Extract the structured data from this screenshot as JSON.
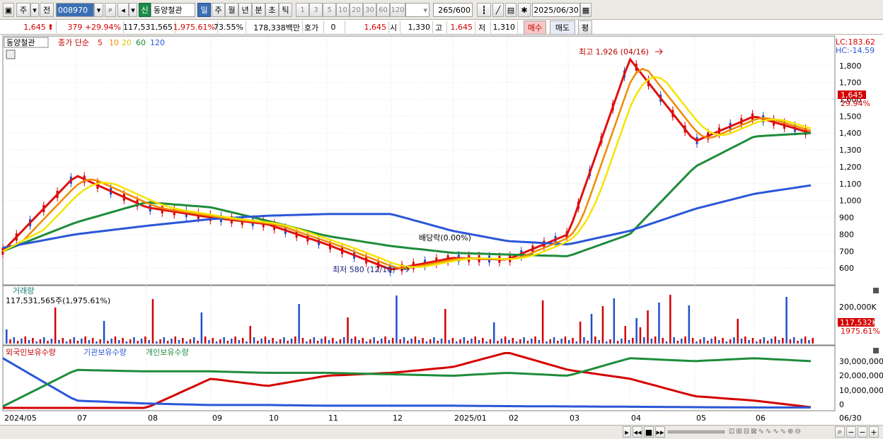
{
  "toolbar": {
    "market": "주",
    "scope": "전",
    "code": "008970",
    "badge": "신",
    "name": "동양철관",
    "periods": [
      "일",
      "주",
      "월",
      "년",
      "분",
      "초",
      "틱"
    ],
    "active_period": "일",
    "intervals": [
      "1",
      "3",
      "5",
      "10",
      "20",
      "30",
      "60",
      "120"
    ],
    "count": "265",
    "count_max": "/600",
    "date": "2025/06/30"
  },
  "quote": {
    "price": "1,645",
    "change": "379",
    "change_pct": "+29.94%",
    "volume": "117,531,565",
    "volume_pct": "1,975.61%",
    "rate": "73.55%",
    "amount": "178,338백만",
    "hoga_label": "호가",
    "hoga_value": "0",
    "ask_price": "1,645",
    "open_label": "시",
    "open": "1,330",
    "high_label": "고",
    "high": "1,645",
    "low_label": "저",
    "low": "1,310",
    "buy_btn": "매수",
    "sell_btn": "매도",
    "eval_btn": "평"
  },
  "price_panel": {
    "stock_label": "동양철관",
    "ma_label": "종가 단순",
    "ma_periods": [
      "5",
      "10",
      "20",
      "60",
      "120"
    ],
    "lc": "LC:183.62",
    "hc": "HC:-14.59",
    "max_note": "최고 1,926 (04/16)",
    "min_note": "최저 580 (12/10)",
    "event_note": "배당락(0.00%)",
    "last_price": "1,645",
    "last_pct": "29.94%",
    "y_ticks": [
      "1,800",
      "1,700",
      "1,600",
      "1,500",
      "1,400",
      "1,300",
      "1,200",
      "1,100",
      "1,000",
      "900",
      "800",
      "700",
      "600"
    ]
  },
  "volume_panel": {
    "title": "거래량",
    "summary": "117,531,565주(1,975.61%)",
    "y_tick": "200,000K",
    "last_value": "117,532K",
    "last_pct": "1975.61%"
  },
  "holdings_panel": {
    "legend": [
      "외국인보유수량",
      "기관보유수량",
      "개인보유수량"
    ],
    "y_ticks": [
      "30,000,000",
      "20,000,000",
      "10,000,000",
      "0"
    ]
  },
  "x_axis": {
    "labels": [
      "2024/05",
      "07",
      "08",
      "09",
      "10",
      "11",
      "12",
      "2025/01",
      "02",
      "03",
      "04",
      "05",
      "06"
    ],
    "right_label": "06/30"
  },
  "colors": {
    "up": "#d40000",
    "down": "#1f50c8",
    "ma5": "#e01010",
    "ma10": "#f08a00",
    "ma20": "#f5e400",
    "ma60": "#1e8c3a",
    "ma120": "#2a56d8"
  },
  "chart_data": {
    "type": "candlestick",
    "ylim": [
      500,
      1950
    ],
    "ma_series": [
      {
        "name": "5",
        "dates": [
          "2024/05",
          "07",
          "08",
          "09",
          "10",
          "11",
          "12",
          "2025/01",
          "02",
          "03",
          "04",
          "05",
          "06",
          "06/30"
        ],
        "values": [
          700,
          1150,
          960,
          900,
          860,
          740,
          590,
          660,
          650,
          800,
          1840,
          1350,
          1500,
          1400
        ]
      },
      {
        "name": "60",
        "dates": [
          "2024/05",
          "07",
          "08",
          "09",
          "10",
          "11",
          "12",
          "2025/01",
          "02",
          "03",
          "04",
          "05",
          "06",
          "06/30"
        ],
        "values": [
          700,
          870,
          990,
          960,
          880,
          790,
          730,
          690,
          680,
          670,
          800,
          1200,
          1380,
          1400
        ]
      },
      {
        "name": "120",
        "dates": [
          "2024/05",
          "07",
          "08",
          "09",
          "10",
          "11",
          "12",
          "2025/01",
          "02",
          "03",
          "04",
          "05",
          "06",
          "06/30"
        ],
        "values": [
          720,
          800,
          850,
          890,
          910,
          920,
          920,
          820,
          760,
          740,
          820,
          950,
          1040,
          1090
        ]
      }
    ]
  }
}
